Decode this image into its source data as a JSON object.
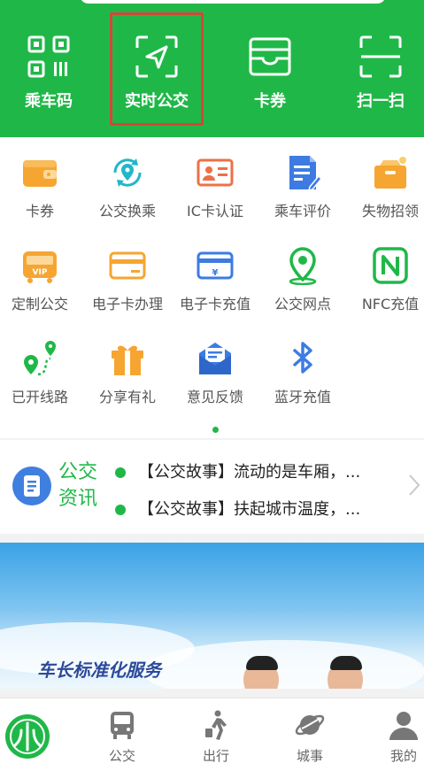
{
  "top_actions": [
    {
      "label": "乘车码",
      "icon": "qr-code-icon"
    },
    {
      "label": "实时公交",
      "icon": "locate-icon"
    },
    {
      "label": "卡券",
      "icon": "wallet-icon"
    },
    {
      "label": "扫一扫",
      "icon": "scan-icon"
    }
  ],
  "grid_items": [
    {
      "label": "卡券",
      "icon": "card-wallet-icon"
    },
    {
      "label": "公交换乘",
      "icon": "transfer-icon"
    },
    {
      "label": "IC卡认证",
      "icon": "id-card-icon"
    },
    {
      "label": "乘车评价",
      "icon": "review-icon"
    },
    {
      "label": "失物招领",
      "icon": "lost-found-icon"
    },
    {
      "label": "定制公交",
      "icon": "vip-bus-icon"
    },
    {
      "label": "电子卡办理",
      "icon": "ecard-icon"
    },
    {
      "label": "电子卡充值",
      "icon": "ecard-recharge-icon"
    },
    {
      "label": "公交网点",
      "icon": "map-pin-icon"
    },
    {
      "label": "NFC充值",
      "icon": "nfc-icon"
    },
    {
      "label": "已开线路",
      "icon": "route-icon"
    },
    {
      "label": "分享有礼",
      "icon": "gift-icon"
    },
    {
      "label": "意见反馈",
      "icon": "feedback-icon"
    },
    {
      "label": "蓝牙充值",
      "icon": "bluetooth-icon"
    }
  ],
  "news": {
    "title_line1": "公交",
    "title_line2": "资讯",
    "items": [
      "【公交故事】流动的是车厢，...",
      "【公交故事】扶起城市温度，..."
    ]
  },
  "banner": {
    "text": "车长标准化服务"
  },
  "bottom_nav": [
    {
      "label": "",
      "icon": "app-logo-icon"
    },
    {
      "label": "公交",
      "icon": "bus-icon"
    },
    {
      "label": "出行",
      "icon": "walking-icon"
    },
    {
      "label": "城事",
      "icon": "planet-icon"
    },
    {
      "label": "我的",
      "icon": "user-icon"
    }
  ],
  "colors": {
    "brand_green": "#1fb848",
    "highlight_red": "#d3473b",
    "news_blue": "#3f7fe0"
  }
}
